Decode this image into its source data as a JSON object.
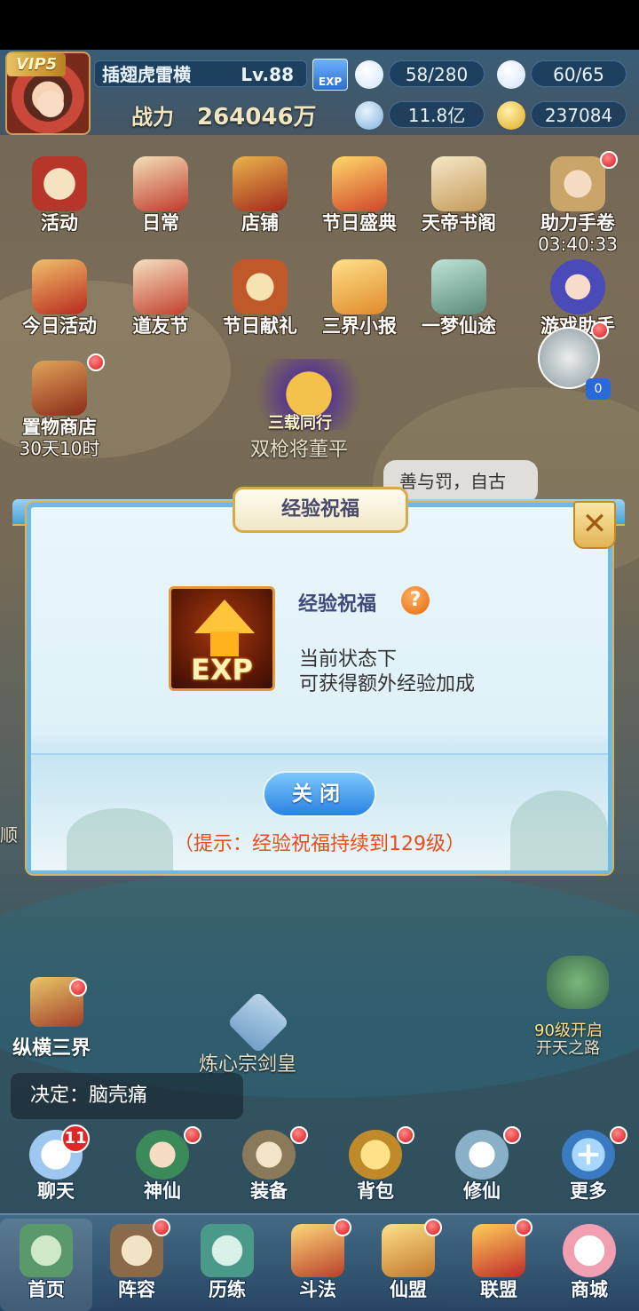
{
  "player": {
    "vip": "VIP5",
    "name": "插翅虎雷横",
    "level": "Lv.88",
    "power_label": "战力",
    "power_value": "264046万"
  },
  "resources": {
    "stamina": "58/280",
    "energy": "60/65",
    "diamond": "11.8亿",
    "gold": "237084"
  },
  "activities": [
    {
      "label": "活动"
    },
    {
      "label": "日常"
    },
    {
      "label": "店铺"
    },
    {
      "label": "节日盛典"
    },
    {
      "label": "天帝书阁"
    },
    {
      "label": "助力手卷",
      "sub": "03:40:33"
    },
    {
      "label": "今日活动"
    },
    {
      "label": "道友节"
    },
    {
      "label": "节日献礼"
    },
    {
      "label": "三界小报"
    },
    {
      "label": "一梦仙途"
    },
    {
      "label": "游戏助手"
    },
    {
      "label": "置物商店",
      "sub": "30天10时"
    }
  ],
  "world": {
    "banner": "三载同行",
    "npc_name": "双枪将董平",
    "chat_snippet": "善与罚，自古",
    "left_edge": "顺",
    "sword_name": "炼心宗剑皇",
    "portal_label": "90级开启",
    "portal_sub": "开天之路",
    "zongheng": "纵横三界",
    "chat_corner": "0"
  },
  "dialog": {
    "title": "经验祝福",
    "buff_name": "经验祝福",
    "exp_icon_text": "EXP",
    "help": "?",
    "line1": "当前状态下",
    "line2": "可获得额外经验加成",
    "close_label": "关闭",
    "tip": "（提示：经验祝福持续到129级）",
    "close_x": "✕"
  },
  "announcement": "决定：脑壳痛",
  "quick_buttons": [
    {
      "label": "聊天",
      "badge": "11"
    },
    {
      "label": "神仙"
    },
    {
      "label": "装备"
    },
    {
      "label": "背包"
    },
    {
      "label": "修仙"
    },
    {
      "label": "更多"
    }
  ],
  "tabs": [
    {
      "label": "首页"
    },
    {
      "label": "阵容"
    },
    {
      "label": "历练"
    },
    {
      "label": "斗法"
    },
    {
      "label": "仙盟"
    },
    {
      "label": "联盟"
    },
    {
      "label": "商城"
    }
  ]
}
